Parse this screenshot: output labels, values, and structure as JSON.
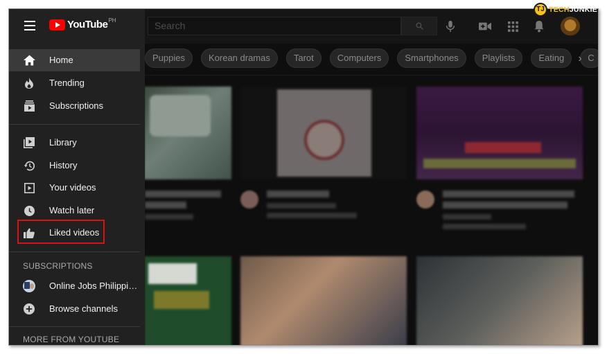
{
  "header": {
    "logo_text": "YouTube",
    "logo_region": "PH",
    "search_placeholder": "Search"
  },
  "watermark": {
    "badge": "TJ",
    "part_a": "TECH",
    "part_b": "JUNKIE"
  },
  "chips": [
    "Puppies",
    "Korean dramas",
    "Tarot",
    "Computers",
    "Smartphones",
    "Playlists",
    "Eating",
    "C"
  ],
  "sidebar": {
    "main": [
      {
        "label": "Home",
        "icon": "home-icon",
        "active": true
      },
      {
        "label": "Trending",
        "icon": "flame-icon"
      },
      {
        "label": "Subscriptions",
        "icon": "subscriptions-icon"
      }
    ],
    "library": [
      {
        "label": "Library",
        "icon": "library-icon"
      },
      {
        "label": "History",
        "icon": "history-icon"
      },
      {
        "label": "Your videos",
        "icon": "your-videos-icon"
      },
      {
        "label": "Watch later",
        "icon": "clock-icon"
      },
      {
        "label": "Liked videos",
        "icon": "thumbs-up-icon",
        "highlighted": true
      }
    ],
    "subscriptions_heading": "SUBSCRIPTIONS",
    "subscriptions": [
      {
        "label": "Online Jobs Philippin...",
        "icon": "channel-avatar"
      },
      {
        "label": "Browse channels",
        "icon": "add-circle-icon"
      }
    ],
    "more_heading": "MORE FROM YOUTUBE"
  },
  "colors": {
    "highlight": "#e01010",
    "youtube_red": "#ff0000",
    "sidebar_bg": "#212121",
    "active_item": "#3a3a3a"
  }
}
